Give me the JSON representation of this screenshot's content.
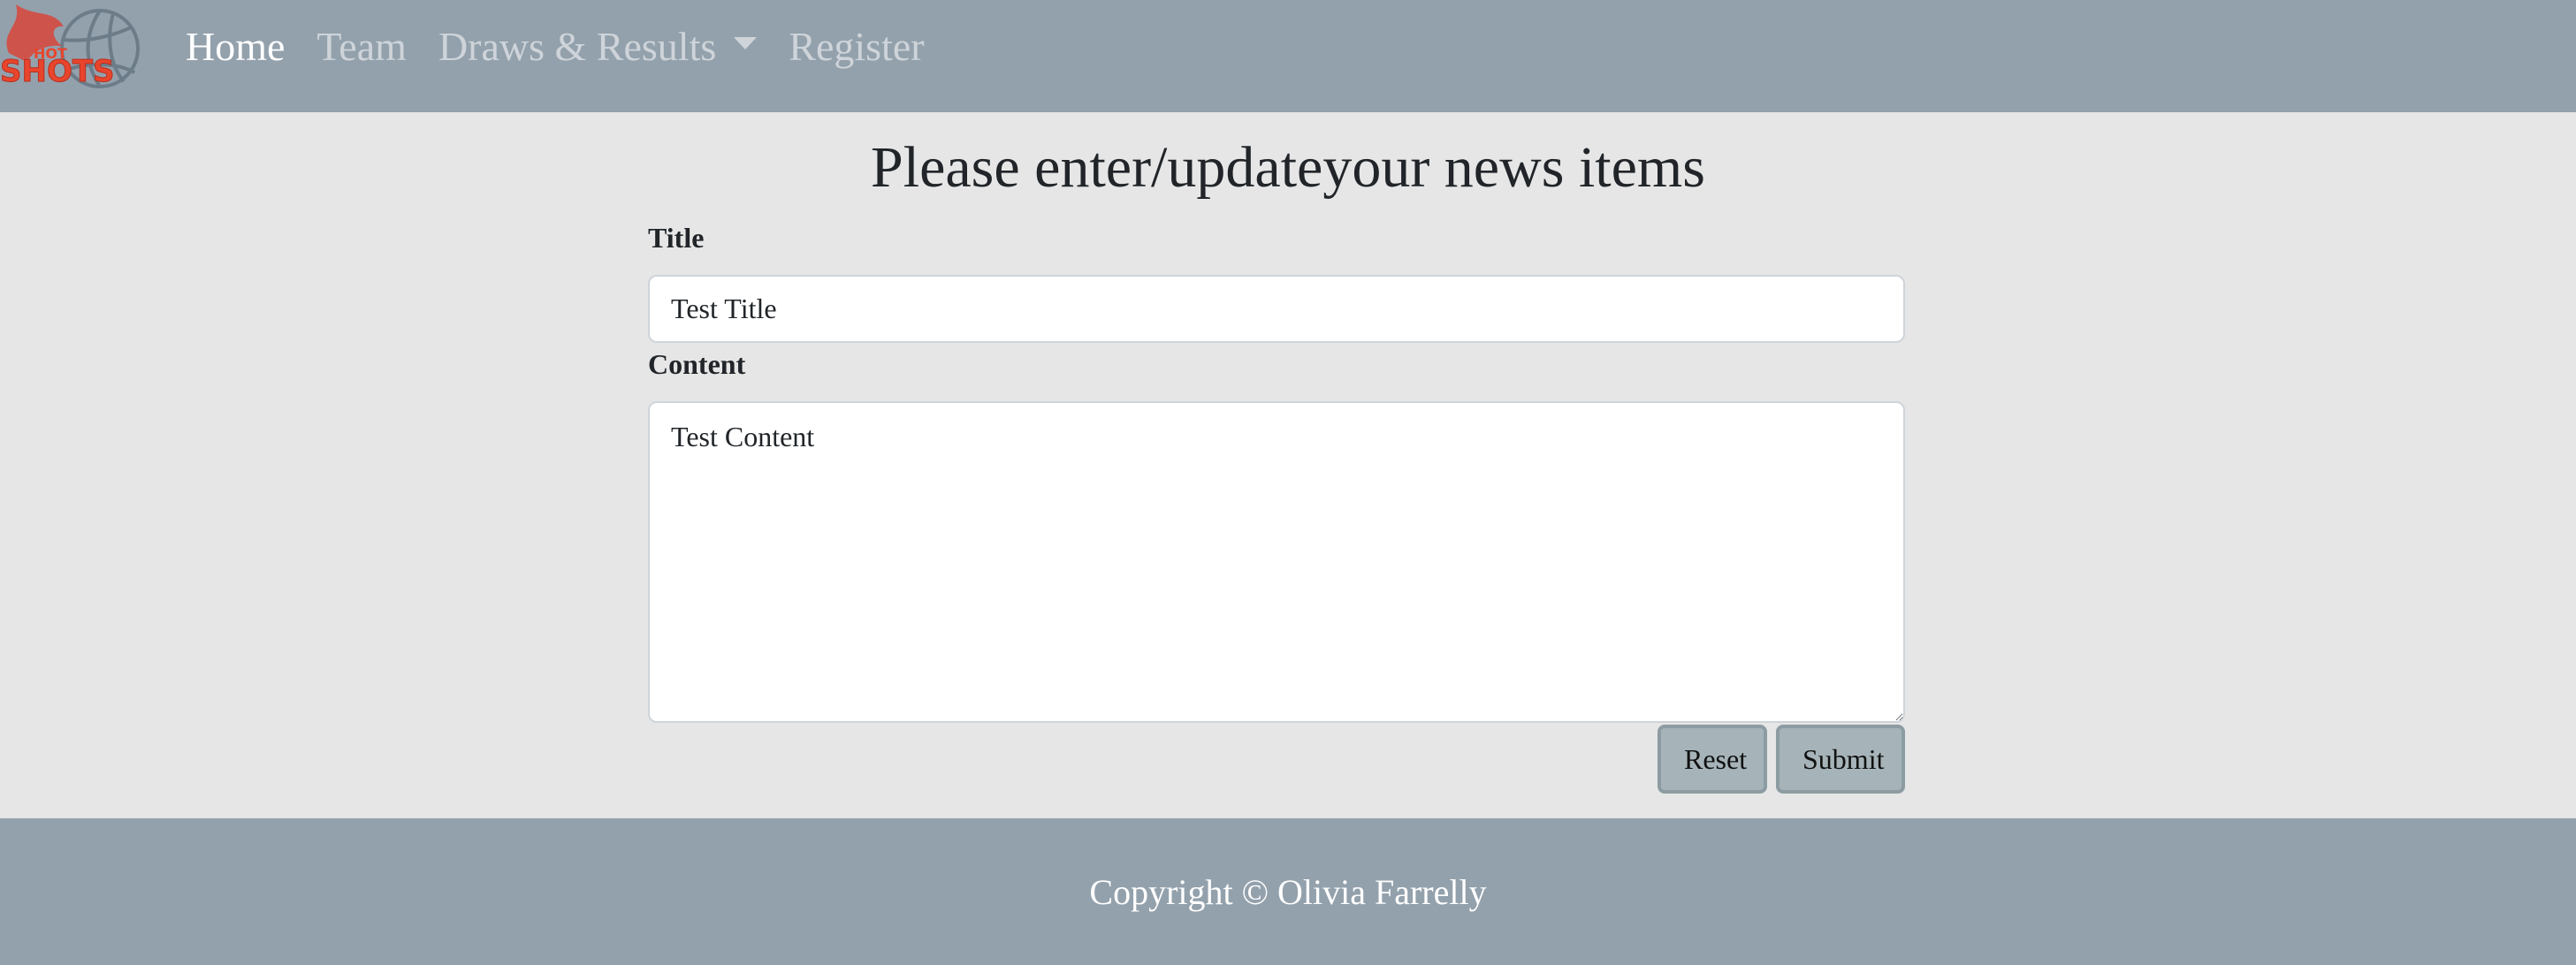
{
  "brand": {
    "logo_text_small": "HOT",
    "logo_text_large": "SHOTS",
    "logo_color": "#e8452c",
    "ball_color": "#6c7c88"
  },
  "nav": {
    "items": [
      {
        "label": "Home",
        "active": true
      },
      {
        "label": "Team",
        "active": false
      },
      {
        "label": "Draws & Results",
        "active": false,
        "dropdown": true
      },
      {
        "label": "Register",
        "active": false
      }
    ]
  },
  "main": {
    "heading": "Please enter/updateyour news items",
    "title_label": "Title",
    "title_value": "Test Title",
    "content_label": "Content",
    "content_value": "Test Content",
    "reset_label": "Reset",
    "submit_label": "Submit"
  },
  "footer": {
    "text": "Copyright © Olivia Farrelly"
  },
  "colors": {
    "navbar_bg": "#93a1ac",
    "page_bg": "#e6e6e6",
    "button_bg": "#a6b4b9"
  }
}
